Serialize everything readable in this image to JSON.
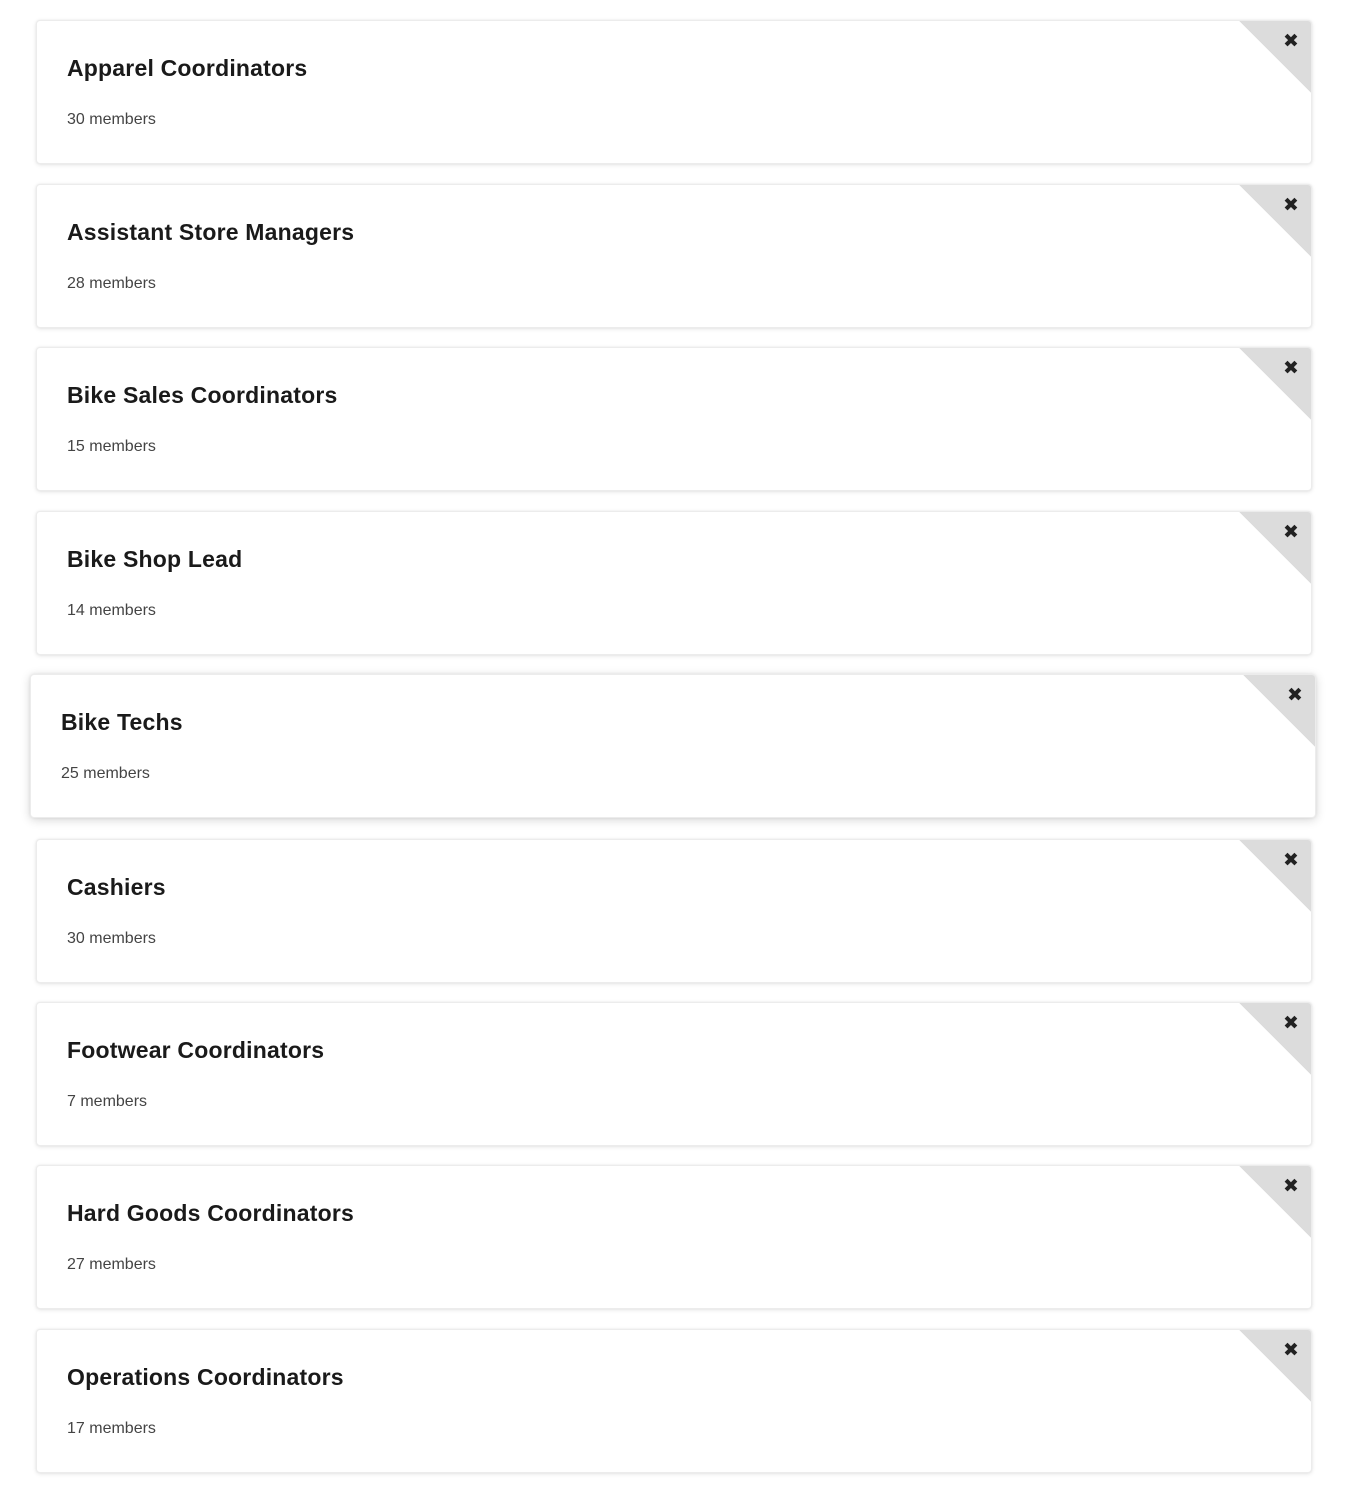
{
  "groups": [
    {
      "name": "Apparel Coordinators",
      "count": "30 members"
    },
    {
      "name": "Assistant Store Managers",
      "count": "28 members"
    },
    {
      "name": "Bike Sales Coordinators",
      "count": "15 members"
    },
    {
      "name": "Bike Shop Lead",
      "count": "14 members"
    },
    {
      "name": "Bike Techs",
      "count": "25 members"
    },
    {
      "name": "Cashiers",
      "count": "30 members"
    },
    {
      "name": "Footwear Coordinators",
      "count": "7 members"
    },
    {
      "name": "Hard Goods Coordinators",
      "count": "27 members"
    },
    {
      "name": "Operations Coordinators",
      "count": "17 members"
    }
  ],
  "icons": {
    "remove": "close-icon",
    "remove_glyph": "✖"
  },
  "colors": {
    "card_background": "#ffffff",
    "corner_fold": "#dcdcdc",
    "title_text": "#1a1a1a",
    "count_text": "#444444"
  }
}
